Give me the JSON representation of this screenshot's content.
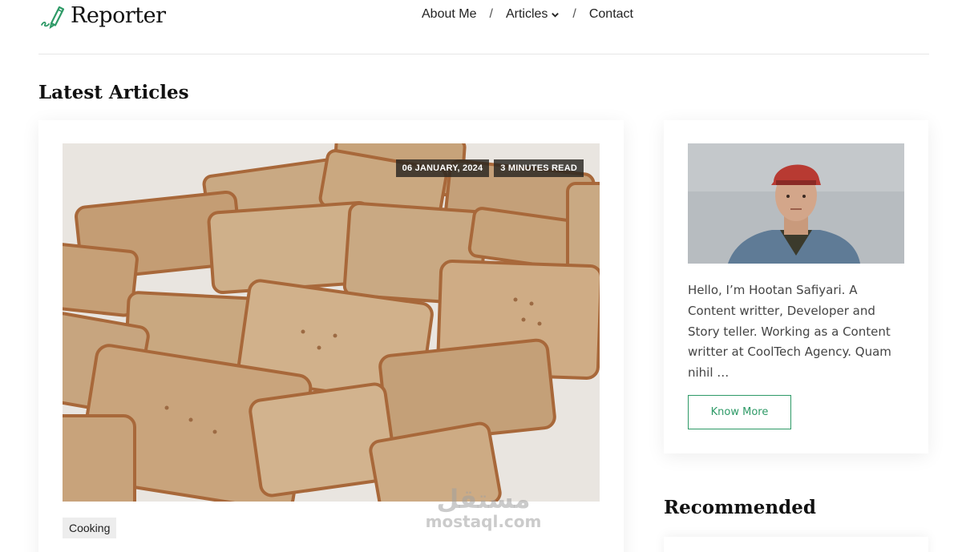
{
  "header": {
    "logo_text": "Reporter",
    "nav": {
      "about": "About Me",
      "articles": "Articles",
      "contact": "Contact",
      "separator": "/"
    }
  },
  "main": {
    "section_title": "Latest Articles",
    "article": {
      "date": "06 JANUARY, 2024",
      "read_time": "3 MINUTES READ",
      "category": "Cooking",
      "image_subject": "square shortbread biscuits"
    }
  },
  "sidebar": {
    "author": {
      "bio": "Hello, I’m Hootan Safiyari. A Content writter, Developer and Story teller. Working as a Content writter at CoolTech Agency. Quam nihil …",
      "button_label": "Know More"
    },
    "recommended_title": "Recommended"
  },
  "watermark": {
    "arabic": "مستقل",
    "latin": "mostaql.com"
  },
  "colors": {
    "accent": "#2e9a67",
    "text": "#1b1b1b",
    "muted_text": "#444444",
    "meta_badge_bg": "#2d2924",
    "category_bg": "#ededed"
  },
  "icons": [
    "pen-logo-icon",
    "chevron-down-icon"
  ]
}
